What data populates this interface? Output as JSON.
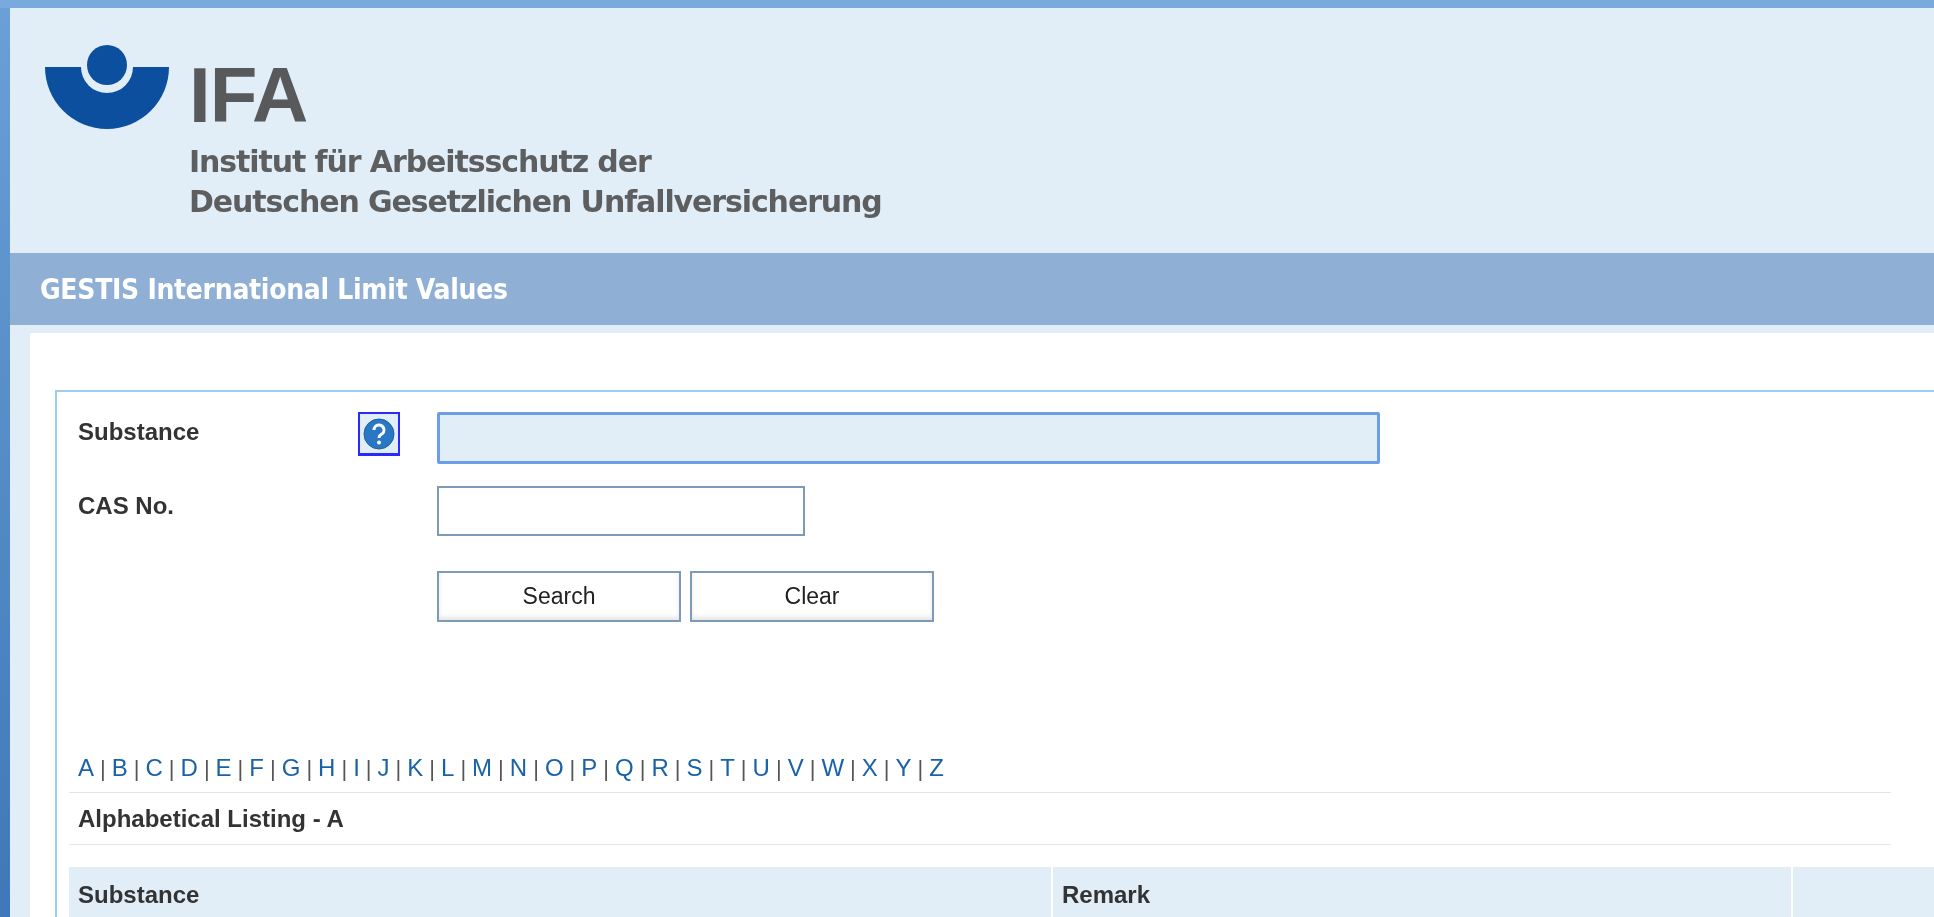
{
  "header": {
    "wordmark": "IFA",
    "subtitle_lines": [
      "Institut für Arbeitsschutz der",
      "Deutschen Gesetzlichen Unfallversicherung"
    ]
  },
  "title_bar": {
    "title": "GESTIS International Limit Values"
  },
  "search_form": {
    "fields": [
      {
        "label": "Substance",
        "help": true,
        "focused": true
      },
      {
        "label": "CAS No.",
        "help": false,
        "focused": false
      }
    ],
    "buttons": [
      "Search",
      "Clear"
    ]
  },
  "alphabet": {
    "separator": "|",
    "letters": [
      "A",
      "B",
      "C",
      "D",
      "E",
      "F",
      "G",
      "H",
      "I",
      "J",
      "K",
      "L",
      "M",
      "N",
      "O",
      "P",
      "Q",
      "R",
      "S",
      "T",
      "U",
      "V",
      "W",
      "X",
      "Y",
      "Z"
    ]
  },
  "listing": {
    "heading": "Alphabetical Listing - A",
    "table": {
      "columns": [
        "Substance",
        "Remark"
      ]
    }
  }
}
